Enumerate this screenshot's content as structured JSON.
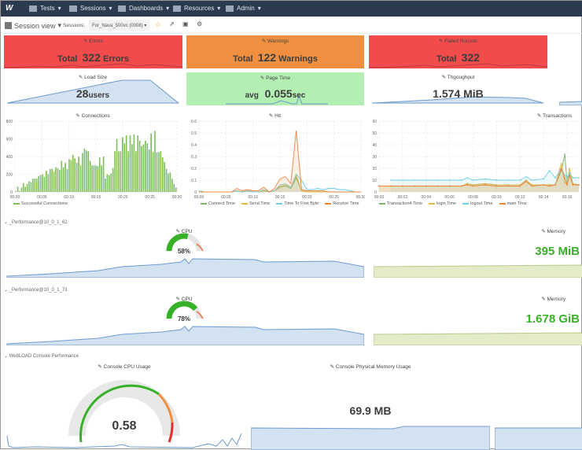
{
  "nav": {
    "items": [
      "Tests",
      "Sessions",
      "Dashboards",
      "Resources",
      "Admin"
    ]
  },
  "toolbar": {
    "view": "Session view",
    "sessions_label": "Sessions:",
    "session_value": "For_Nava_500vc (0008)"
  },
  "stats": {
    "errors": {
      "title": "Errors",
      "prefix": "Total",
      "value": "322",
      "suffix": "Errors",
      "color": "#f24b4b"
    },
    "warnings": {
      "title": "Warnings",
      "prefix": "Total",
      "value": "122",
      "suffix": "Warnings",
      "color": "#ef8f3f"
    },
    "failed": {
      "title": "Failed Rounds",
      "prefix": "Total",
      "value": "322",
      "color": "#f24b4b"
    },
    "load": {
      "title": "Load Size",
      "value": "28",
      "suffix": "users"
    },
    "page": {
      "title": "Page Time",
      "prefix": "avg",
      "value": "0.055",
      "suffix": "sec",
      "color": "#b3efb2"
    },
    "throughput": {
      "title": "Thgoughput",
      "value": "1.574 MiB"
    }
  },
  "chart_data": [
    {
      "type": "bar",
      "title": "Connections",
      "ylim": [
        0,
        800
      ],
      "yticks": [
        0,
        200,
        400,
        600,
        800
      ],
      "xticks": [
        "00:00",
        "00:05",
        "00:10",
        "00:15",
        "00:20",
        "00:25",
        "00:30"
      ],
      "xlim": [
        0,
        30
      ],
      "series": [
        {
          "name": "Successful Connections",
          "color": "#7ebf5c",
          "values": [
            10,
            60,
            10,
            50,
            100,
            60,
            90,
            120,
            110,
            150,
            150,
            150,
            180,
            190,
            200,
            170,
            240,
            200,
            260,
            260,
            230,
            280,
            270,
            250,
            350,
            280,
            330,
            260,
            370,
            360,
            420,
            380,
            330,
            400,
            300,
            440,
            490,
            470,
            460,
            350,
            300,
            300,
            300,
            290,
            390,
            300,
            400,
            150,
            200,
            190,
            210,
            270,
            460,
            600,
            460,
            460,
            620,
            550,
            640,
            460,
            640,
            540,
            650,
            460,
            640,
            580,
            520,
            540,
            580,
            550,
            480,
            660,
            450,
            690,
            450,
            450,
            460,
            390,
            340,
            260,
            210,
            220,
            150,
            90,
            50
          ]
        }
      ]
    },
    {
      "type": "line",
      "title": "Hit",
      "ylim": [
        0,
        0.6
      ],
      "yticks": [
        0,
        0.1,
        0.2,
        0.3,
        0.4,
        0.5,
        0.6
      ],
      "xticks": [
        "00:00",
        "00:05",
        "00:10",
        "00:15",
        "00:20",
        "00:25",
        "00:30"
      ],
      "xlim": [
        0,
        30
      ],
      "x": [
        0,
        1,
        2,
        3,
        4,
        5,
        6,
        7,
        8,
        9,
        10,
        11,
        12,
        13,
        14,
        15,
        16,
        17,
        18,
        19,
        20,
        21,
        22,
        23,
        24,
        25,
        26,
        27,
        28,
        29,
        30
      ],
      "series": [
        {
          "name": "Connect Time",
          "color": "#7eb26d",
          "values": [
            0,
            0,
            0,
            0,
            0,
            0,
            0,
            0.01,
            0,
            0.01,
            0,
            0,
            0.01,
            0,
            0.01,
            0.04,
            0.05,
            0.03,
            0.12,
            0.01,
            0,
            0,
            0,
            0,
            0,
            0,
            0,
            0,
            0,
            0,
            0
          ]
        },
        {
          "name": "Send Time",
          "color": "#eab839",
          "values": [
            0,
            0,
            0,
            0,
            0,
            0,
            0,
            0.01,
            0,
            0.01,
            0,
            0,
            0.01,
            0,
            0.01,
            0.05,
            0.06,
            0.04,
            0.14,
            0.01,
            0,
            0,
            0,
            0,
            0,
            0,
            0,
            0,
            0,
            0,
            0
          ]
        },
        {
          "name": "Time To First Byte",
          "color": "#6ed0e0",
          "values": [
            0.01,
            0,
            0,
            0,
            0,
            0,
            0,
            0.01,
            0,
            0.01,
            0,
            0,
            0.02,
            0,
            0.01,
            0.06,
            0.07,
            0.04,
            0.15,
            0.1,
            0.02,
            0.02,
            0.03,
            0.02,
            0.03,
            0.03,
            0.02,
            0.02,
            0.01,
            0,
            0
          ]
        },
        {
          "name": "Receive Time",
          "color": "#ef843c",
          "values": [
            0,
            0,
            0,
            0,
            0,
            0,
            0,
            0.03,
            0.01,
            0.02,
            0.01,
            0.01,
            0.04,
            0,
            0.03,
            0.11,
            0.13,
            0.07,
            0.52,
            0.02,
            0.01,
            0.01,
            0.01,
            0.01,
            0,
            0,
            0,
            0,
            0,
            0,
            0
          ]
        }
      ]
    },
    {
      "type": "line",
      "title": "Transactions",
      "ylim": [
        0,
        60
      ],
      "yticks": [
        0,
        10,
        20,
        30,
        40,
        50,
        60
      ],
      "xticks": [
        "00:00",
        "00:02",
        "00:04",
        "00:06",
        "00:08",
        "00:10",
        "00:12",
        "00:14",
        "00:16"
      ],
      "xlim": [
        0,
        17
      ],
      "x": [
        0,
        1,
        2,
        3,
        4,
        5,
        6,
        7,
        7.5,
        8,
        9,
        10,
        11,
        12,
        12.5,
        13,
        14,
        14.5,
        15,
        15.5,
        15.8,
        16,
        16.2,
        16.5,
        17
      ],
      "series": [
        {
          "name": "Transaction4 Time",
          "color": "#7eb26d",
          "values": [
            5,
            5,
            5,
            5,
            5,
            5,
            5,
            5,
            7,
            6,
            7,
            6,
            6,
            6,
            9,
            6,
            6,
            6,
            6,
            18,
            32,
            8,
            15,
            7,
            6
          ]
        },
        {
          "name": "login Time",
          "color": "#eab839",
          "values": [
            5,
            5,
            5,
            5,
            5,
            5,
            5,
            5,
            7,
            6,
            7,
            6,
            6,
            6,
            10,
            6,
            6,
            6,
            6,
            24,
            8,
            6,
            20,
            7,
            6
          ]
        },
        {
          "name": "logout Time",
          "color": "#6ed0e0",
          "values": [
            null,
            10,
            10,
            10,
            10,
            10,
            10,
            10,
            12,
            10,
            11,
            10,
            10,
            10,
            13,
            10,
            11,
            18,
            12,
            20,
            14,
            12,
            16,
            12,
            12
          ]
        },
        {
          "name": "main Time",
          "color": "#ef843c",
          "values": [
            5,
            5,
            5,
            5,
            5,
            5,
            5,
            5,
            6,
            5,
            6,
            5,
            5,
            5,
            9,
            5,
            6,
            5,
            6,
            20,
            12,
            6,
            14,
            6,
            6
          ]
        }
      ]
    }
  ],
  "sections": [
    {
      "title": "_Performance@10_0_1_62",
      "cpu_title": "CPU",
      "cpu_value": "58%",
      "cpu_fraction": 0.58,
      "mem_title": "Memory",
      "mem_value": "395 MiB"
    },
    {
      "title": "_Performance@10_0_1_73",
      "cpu_title": "CPU",
      "cpu_value": "78%",
      "cpu_fraction": 0.78,
      "mem_title": "Memory",
      "mem_value": "1.678 GiB"
    }
  ],
  "console": {
    "title": "WebLOAD Console Performance",
    "cpu_title": "Console CPU Usage",
    "cpu_value": "0.58",
    "mem_title": "Console Physical Memory Usage",
    "mem_value": "69.9 MB"
  },
  "colors": {
    "nav": "#2b3a4e",
    "green": "#37b127",
    "star": "#f5a623"
  }
}
